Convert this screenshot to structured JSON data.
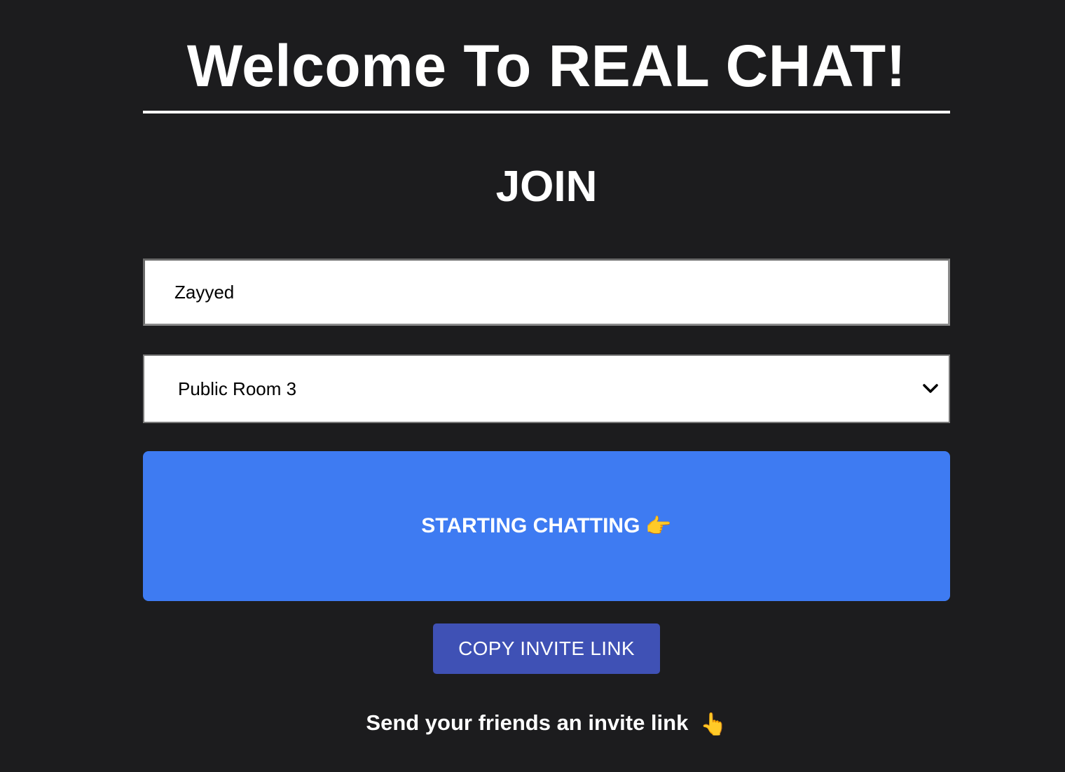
{
  "header": {
    "title": "Welcome To REAL CHAT!"
  },
  "form": {
    "heading": "JOIN",
    "name_input": {
      "value": "Zayyed",
      "placeholder": ""
    },
    "room_select": {
      "selected": "Public Room 3",
      "icon": "chevron-down-icon"
    },
    "start_button": {
      "label": "STARTING CHATTING",
      "emoji": "👉"
    },
    "copy_button": {
      "label": "COPY INVITE LINK"
    },
    "invite_hint": {
      "text": "Send your friends an invite link",
      "emoji": "👆"
    }
  },
  "colors": {
    "background": "#1c1c1e",
    "start_button": "#3e7bf2",
    "copy_button": "#3f51b5",
    "text": "#ffffff"
  }
}
